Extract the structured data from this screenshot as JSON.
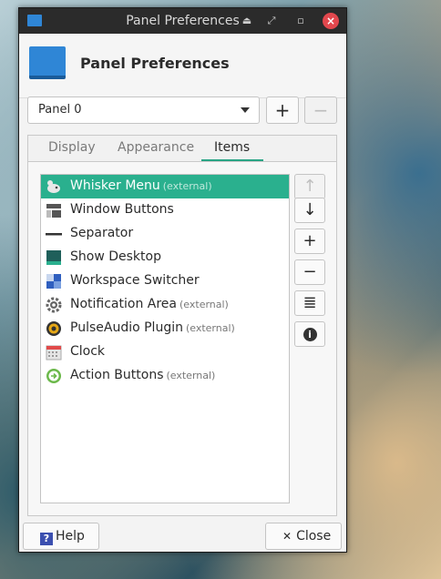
{
  "window": {
    "title": "Panel Preferences",
    "controls": {
      "minimize": "⏏",
      "maximize": "⤢",
      "restore": "▫",
      "close": "×"
    }
  },
  "header": {
    "title": "Panel Preferences"
  },
  "panel_select": {
    "value": "Panel 0",
    "add": "+",
    "remove": "−"
  },
  "tabs": [
    {
      "label": "Display",
      "active": false
    },
    {
      "label": "Appearance",
      "active": false
    },
    {
      "label": "Items",
      "active": true
    }
  ],
  "items": [
    {
      "label": "Whisker Menu",
      "tag": "(external)",
      "icon": "whisker-menu-icon",
      "selected": true
    },
    {
      "label": "Window Buttons",
      "tag": "",
      "icon": "window-buttons-icon",
      "selected": false
    },
    {
      "label": "Separator",
      "tag": "",
      "icon": "separator-icon",
      "selected": false
    },
    {
      "label": "Show Desktop",
      "tag": "",
      "icon": "show-desktop-icon",
      "selected": false
    },
    {
      "label": "Workspace Switcher",
      "tag": "",
      "icon": "workspace-switcher-icon",
      "selected": false
    },
    {
      "label": "Notification Area",
      "tag": "(external)",
      "icon": "notification-area-icon",
      "selected": false
    },
    {
      "label": "PulseAudio Plugin",
      "tag": "(external)",
      "icon": "pulseaudio-icon",
      "selected": false
    },
    {
      "label": "Clock",
      "tag": "",
      "icon": "clock-icon",
      "selected": false
    },
    {
      "label": "Action Buttons",
      "tag": "(external)",
      "icon": "action-buttons-icon",
      "selected": false
    }
  ],
  "side_buttons": {
    "up": "↑",
    "down": "↓",
    "add": "+",
    "remove": "−",
    "edit": "≣",
    "about": "i"
  },
  "footer": {
    "help": "Help",
    "close": "Close",
    "close_glyph": "✕",
    "help_glyph": "?"
  },
  "colors": {
    "accent": "#2ab08e",
    "titlebar": "#2b2b2b",
    "close": "#e2474d"
  }
}
